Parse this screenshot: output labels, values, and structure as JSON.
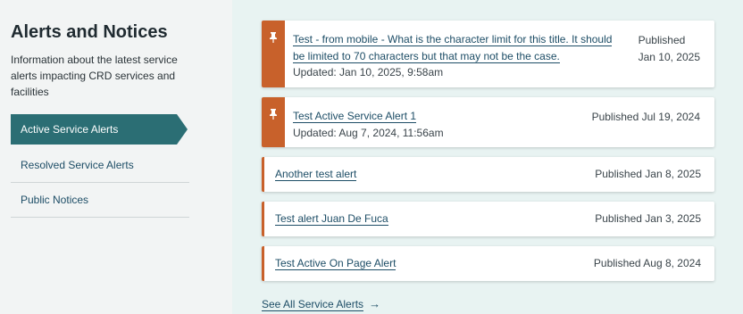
{
  "sidebar": {
    "title": "Alerts and Notices",
    "description": "Information about the latest service alerts impacting CRD services and facilities",
    "nav": [
      {
        "label": "Active Service Alerts"
      },
      {
        "label": "Resolved Service Alerts"
      },
      {
        "label": "Public Notices"
      }
    ]
  },
  "alerts": [
    {
      "title": "Test - from mobile - What is the character limit for this title. It should be limited to 70 characters but that may not be the case.",
      "updated": "Updated: Jan 10, 2025, 9:58am",
      "published": "Published\nJan 10, 2025"
    },
    {
      "title": "Test Active Service Alert 1",
      "updated": "Updated: Aug 7, 2024, 11:56am",
      "published": "Published Jul 19, 2024"
    },
    {
      "title": "Another test alert",
      "published": "Published Jan 8, 2025"
    },
    {
      "title": "Test alert Juan De Fuca",
      "published": "Published Jan 3, 2025"
    },
    {
      "title": "Test Active On Page Alert",
      "published": "Published Aug 8, 2024"
    }
  ],
  "see_all": {
    "label": "See All Service Alerts",
    "arrow_icon": "arrow-right-icon"
  },
  "colors": {
    "accent_orange": "#c8612b",
    "teal": "#2b6e74",
    "link": "#1d4d66",
    "main_bg": "#e8f3f2"
  }
}
